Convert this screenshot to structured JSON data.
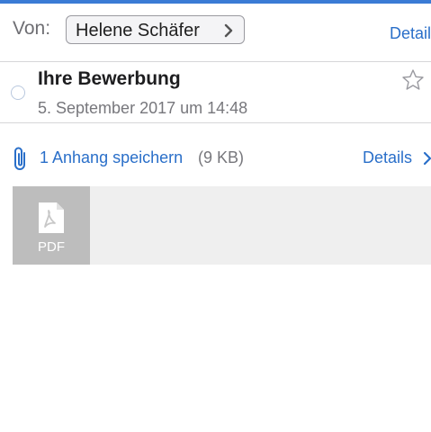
{
  "colors": {
    "accent": "#2a6fc9",
    "top_bar": "#3a7bd5",
    "muted_text": "#77777c",
    "pdf_tile": "#bdbdbd",
    "attachment_strip": "#efefef"
  },
  "header": {
    "from_label": "Von:",
    "sender": "Helene Schäfer",
    "details_label": "Detail"
  },
  "message": {
    "subject": "Ihre Bewerbung",
    "date": "5. September 2017 um 14:48"
  },
  "attachments": {
    "save_label": "1 Anhang speichern",
    "size": "(9 KB)",
    "details_label": "Details",
    "items": [
      {
        "type": "PDF",
        "icon": "pdf-file-icon"
      }
    ]
  },
  "icons": {
    "sender_chevron": "chevron-right-icon",
    "star": "star-outline-icon",
    "unread": "unread-dot-icon",
    "paperclip": "paperclip-icon",
    "details_chevron": "chevron-right-icon"
  }
}
